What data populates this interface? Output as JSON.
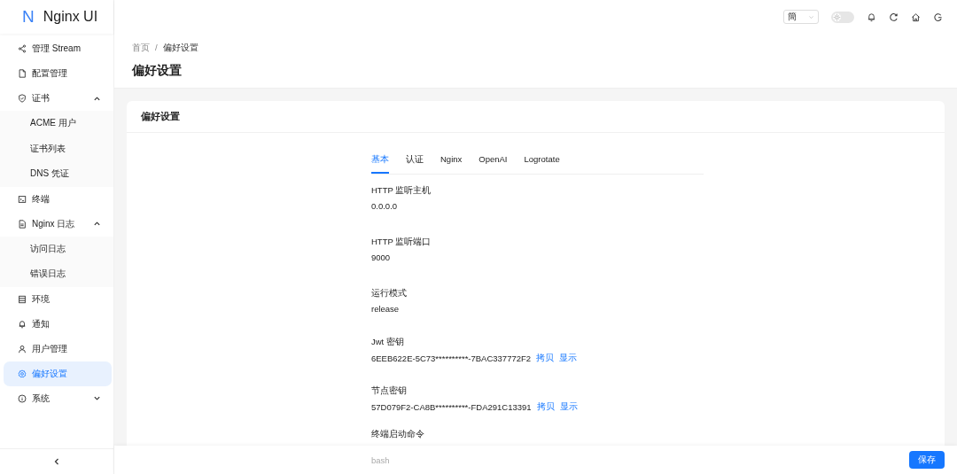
{
  "logo": {
    "text": "Nginx UI",
    "mark": "N"
  },
  "sidebar": {
    "items": [
      {
        "label": "管理 Stream",
        "selected": false
      },
      {
        "label": "配置管理",
        "selected": false
      },
      {
        "label": "证书",
        "selected": false,
        "expanded": true,
        "children": [
          {
            "label": "ACME 用户",
            "selected": false
          },
          {
            "label": "证书列表",
            "selected": false
          },
          {
            "label": "DNS 凭证",
            "selected": false
          }
        ]
      },
      {
        "label": "终端",
        "selected": false
      },
      {
        "label": "Nginx 日志",
        "selected": false,
        "expanded": true,
        "children": [
          {
            "label": "访问日志",
            "selected": false
          },
          {
            "label": "错误日志",
            "selected": false
          }
        ]
      },
      {
        "label": "环境",
        "selected": false
      },
      {
        "label": "通知",
        "selected": false
      },
      {
        "label": "用户管理",
        "selected": false
      },
      {
        "label": "偏好设置",
        "selected": true
      },
      {
        "label": "系统",
        "selected": false,
        "expanded": false
      }
    ]
  },
  "header": {
    "language": "簡",
    "dark_mode": false
  },
  "breadcrumb": {
    "items": [
      "首页",
      "偏好设置"
    ],
    "separator": "/"
  },
  "page_title": "偏好设置",
  "card": {
    "title": "偏好设置",
    "tabs": [
      {
        "label": "基本",
        "selected": true
      },
      {
        "label": "认证",
        "selected": false
      },
      {
        "label": "Nginx",
        "selected": false
      },
      {
        "label": "OpenAI",
        "selected": false
      },
      {
        "label": "Logrotate",
        "selected": false
      }
    ],
    "fields": [
      {
        "label": "HTTP 监听主机",
        "value": "0.0.0.0"
      },
      {
        "label": "HTTP 监听端口",
        "value": "9000"
      },
      {
        "label": "运行模式",
        "value": "release"
      },
      {
        "label": "Jwt 密钥",
        "value": "6EEB622E-5C73**********-7BAC337772F2",
        "actions": [
          "拷贝",
          "显示"
        ]
      },
      {
        "label": "节点密钥",
        "value": "57D079F2-CA8B**********-FDA291C13391",
        "actions": [
          "拷贝",
          "显示"
        ]
      },
      {
        "label": "终端启动命令",
        "value": "bash"
      }
    ]
  },
  "save_button": "保存"
}
